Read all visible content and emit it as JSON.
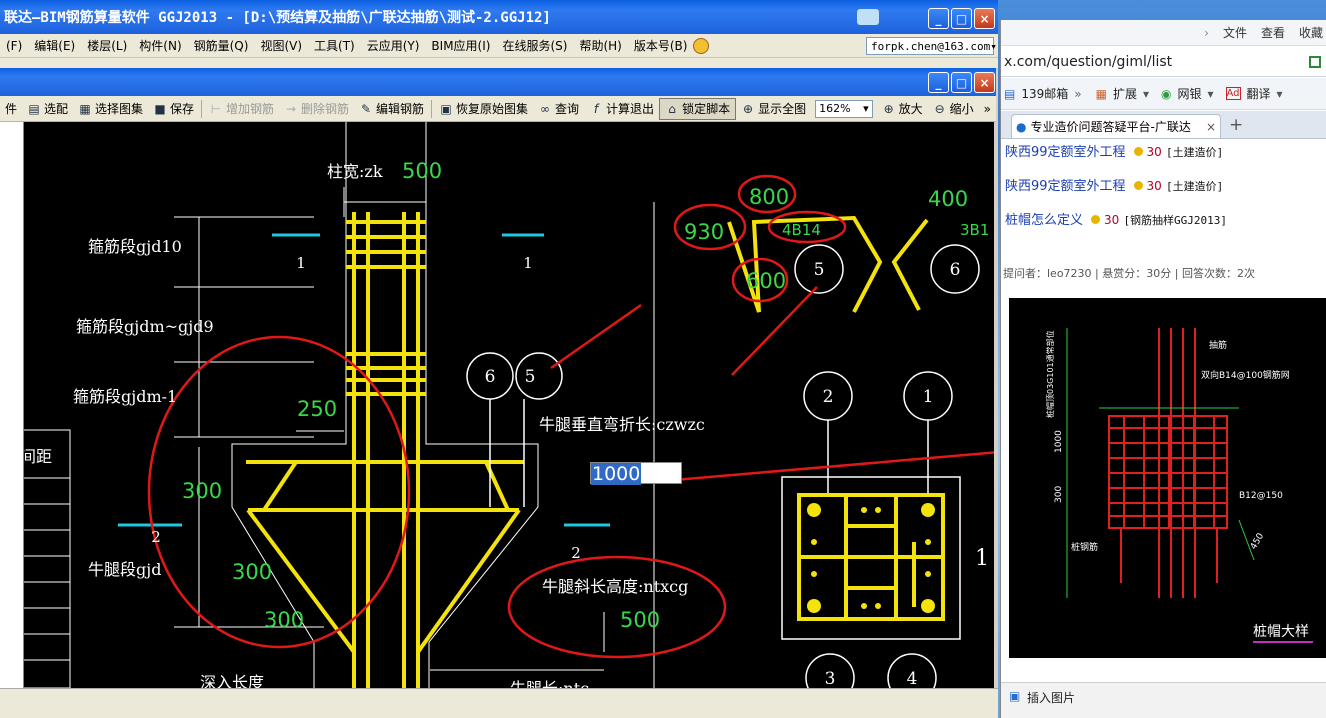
{
  "main_window": {
    "title": "联达—BIM钢筋算量软件 GGJ2013 - [D:\\预结算及抽筋\\广联达抽筋\\测试-2.GGJ12]",
    "menu": [
      "(F)",
      "编辑(E)",
      "楼层(L)",
      "构件(N)",
      "钢筋量(Q)",
      "视图(V)",
      "工具(T)",
      "云应用(Y)",
      "BIM应用(I)",
      "在线服务(S)",
      "帮助(H)",
      "版本号(B)"
    ],
    "email": "forpk.chen@163.com",
    "toolbar": {
      "t0": "件",
      "select": "选配",
      "select_atlas": "选择图集",
      "save": "保存",
      "add_rebar": "增加钢筋",
      "delete_rebar": "删除钢筋",
      "edit_rebar": "编辑钢筋",
      "restore_atlas": "恢复原始图集",
      "query": "查询",
      "calc_exit": "计算退出",
      "lock_script": "锁定脚本",
      "show_all": "显示全图",
      "zoom": "162%",
      "zoom_in": "放大",
      "zoom_out": "缩小"
    },
    "editor_value": "1000",
    "left_panel_label": "间距"
  },
  "drawing": {
    "labels": {
      "col_width": "柱宽:zk",
      "col_width_val": "500",
      "hoop1": "箍筋段gjd10",
      "hoop2": "箍筋段gjdm~gjd9",
      "hoop3": "箍筋段gjdm-1",
      "corbel_seg": "牛腿段gjd",
      "corbel_vert": "牛腿垂直弯折长:czwzc",
      "corbel_slope": "牛腿斜长高度:ntxcg",
      "embed": "深入长度",
      "corbel_len": "牛腿长:ntc",
      "rebar_tag": "4B14",
      "rebar_tag2": "3B1"
    },
    "numbers": {
      "n250": "250",
      "n300a": "300",
      "n300b": "300",
      "n300c": "300",
      "n500": "500",
      "n800": "800",
      "n930": "930",
      "n600": "600",
      "n400": "400",
      "one": "1",
      "two": "2",
      "c1": "1",
      "c2": "2",
      "c3": "3",
      "c4": "4",
      "c5": "5",
      "c6": "6",
      "edge1": "1"
    }
  },
  "browser": {
    "menu": [
      "文件",
      "查看",
      "收藏"
    ],
    "address": "x.com/question/giml/list",
    "bookmarks": [
      "139邮箱",
      "扩展",
      "网银",
      "翻译"
    ],
    "tab_title": "专业造价问题答疑平台-广联达",
    "links": [
      {
        "title": "陕西99定额室外工程",
        "points": "30",
        "category": "[土建造价]"
      },
      {
        "title": "陕西99定额室外工程",
        "points": "30",
        "category": "[土建造价]"
      },
      {
        "title": "桩帽怎么定义",
        "points": "30",
        "category": "[钢筋抽样GGJ2013]"
      }
    ],
    "info": "提问者：leo7230  |  悬赏分：30分  |  回答次数：2次",
    "insert_image": "插入图片",
    "image": {
      "top_label": "抽筋",
      "mesh_label": "双向B14@100钢筋网",
      "hoop_label": "B12@150",
      "pile_label": "桩钢筋",
      "dim_1000": "1000",
      "dim_300": "300",
      "dim_450": "450",
      "side_label": "桩帽顶03G101通常部位",
      "caption": "桩帽大样"
    }
  }
}
